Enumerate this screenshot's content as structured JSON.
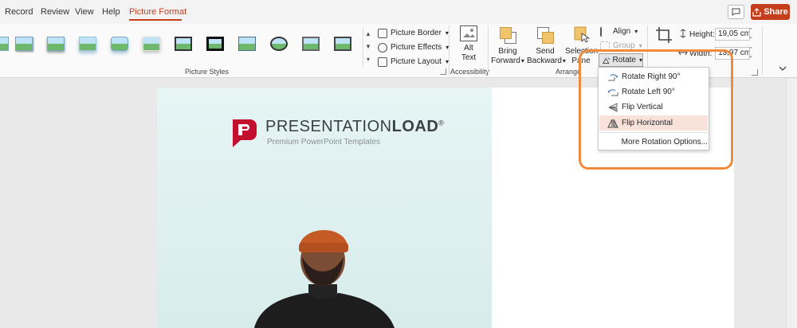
{
  "tabs": [
    {
      "label": "Record"
    },
    {
      "label": "Review"
    },
    {
      "label": "View"
    },
    {
      "label": "Help"
    },
    {
      "label": "Picture Format",
      "active": true
    }
  ],
  "share_label": "Share",
  "ribbon": {
    "picture_styles": {
      "label": "Picture Styles",
      "border_label": "Picture Border",
      "effects_label": "Picture Effects",
      "layout_label": "Picture Layout"
    },
    "accessibility": {
      "label": "Accessibility",
      "alt_text_line1": "Alt",
      "alt_text_line2": "Text"
    },
    "arrange": {
      "label": "Arrange",
      "bring_forward_line1": "Bring",
      "bring_forward_line2": "Forward",
      "send_backward_line1": "Send",
      "send_backward_line2": "Backward",
      "selection_pane_line1": "Selection",
      "selection_pane_line2": "Pane",
      "align_label": "Align",
      "group_label": "Group",
      "rotate_label": "Rotate"
    },
    "size": {
      "height_label": "Height:",
      "height_value": "19,05 cm",
      "width_label": "Width:",
      "width_value": "13,97 cm"
    }
  },
  "rotate_menu": [
    {
      "label": "Rotate Right 90°",
      "icon": "rotate-right-icon"
    },
    {
      "label": "Rotate Left 90°",
      "icon": "rotate-left-icon"
    },
    {
      "label": "Flip Vertical",
      "icon": "flip-vertical-icon"
    },
    {
      "label": "Flip Horizontal",
      "icon": "flip-horizontal-icon",
      "highlighted": true
    },
    {
      "label": "More Rotation Options..."
    }
  ],
  "slide": {
    "logo_light": "PRESENTATION",
    "logo_bold": "LOAD",
    "logo_reg": "®",
    "logo_subtitle": "Premium PowerPoint Templates"
  },
  "colors": {
    "accent": "#c43e1c",
    "highlight_ring": "#f08a3c",
    "menu_highlight": "#f9e2da"
  }
}
